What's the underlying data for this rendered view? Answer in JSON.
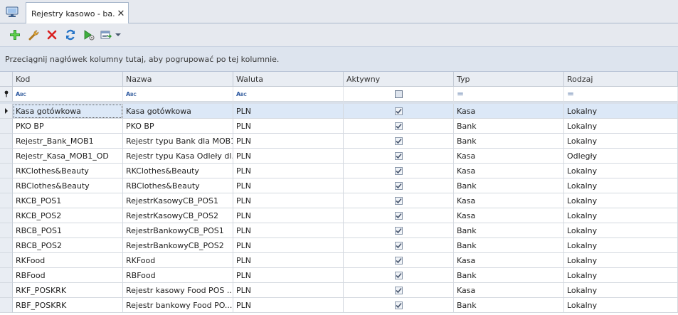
{
  "tab": {
    "label": "Rejestry kasowo - ba...",
    "close": "✕"
  },
  "toolbar": {
    "icons": [
      "add-icon",
      "edit-icon",
      "delete-icon",
      "refresh-icon",
      "run-icon",
      "export-icon",
      "dropdown-arrow-icon"
    ]
  },
  "groupbar": {
    "hint": "Przeciągnij nagłówek kolumny tutaj, aby pogrupować po tej kolumnie."
  },
  "columns": {
    "kod": "Kod",
    "nazwa": "Nazwa",
    "waluta": "Waluta",
    "aktywny": "Aktywny",
    "typ": "Typ",
    "rodzaj": "Rodzaj"
  },
  "filter": {
    "abc": "ABC",
    "eq": "="
  },
  "rows": [
    {
      "kod": "Kasa gotówkowa",
      "nazwa": "Kasa gotówkowa",
      "waluta": "PLN",
      "aktywny": true,
      "typ": "Kasa",
      "rodzaj": "Lokalny"
    },
    {
      "kod": "PKO BP",
      "nazwa": "PKO BP",
      "waluta": "PLN",
      "aktywny": true,
      "typ": "Bank",
      "rodzaj": "Lokalny"
    },
    {
      "kod": "Rejestr_Bank_MOB1",
      "nazwa": "Rejestr typu Bank dla MOB1",
      "waluta": "PLN",
      "aktywny": true,
      "typ": "Bank",
      "rodzaj": "Lokalny"
    },
    {
      "kod": "Rejestr_Kasa_MOB1_OD",
      "nazwa": "Rejestr typu Kasa Odleły dl...",
      "waluta": "PLN",
      "aktywny": true,
      "typ": "Kasa",
      "rodzaj": "Odległy"
    },
    {
      "kod": "RKClothes&Beauty",
      "nazwa": "RKClothes&Beauty",
      "waluta": "PLN",
      "aktywny": true,
      "typ": "Kasa",
      "rodzaj": "Lokalny"
    },
    {
      "kod": "RBClothes&Beauty",
      "nazwa": "RBClothes&Beauty",
      "waluta": "PLN",
      "aktywny": true,
      "typ": "Bank",
      "rodzaj": "Lokalny"
    },
    {
      "kod": "RKCB_POS1",
      "nazwa": "RejestrKasowyCB_POS1",
      "waluta": "PLN",
      "aktywny": true,
      "typ": "Kasa",
      "rodzaj": "Lokalny"
    },
    {
      "kod": "RKCB_POS2",
      "nazwa": "RejestrKasowyCB_POS2",
      "waluta": "PLN",
      "aktywny": true,
      "typ": "Kasa",
      "rodzaj": "Lokalny"
    },
    {
      "kod": "RBCB_POS1",
      "nazwa": "RejestrBankowyCB_POS1",
      "waluta": "PLN",
      "aktywny": true,
      "typ": "Bank",
      "rodzaj": "Lokalny"
    },
    {
      "kod": "RBCB_POS2",
      "nazwa": "RejestrBankowyCB_POS2",
      "waluta": "PLN",
      "aktywny": true,
      "typ": "Bank",
      "rodzaj": "Lokalny"
    },
    {
      "kod": "RKFood",
      "nazwa": "RKFood",
      "waluta": "PLN",
      "aktywny": true,
      "typ": "Kasa",
      "rodzaj": "Lokalny"
    },
    {
      "kod": "RBFood",
      "nazwa": "RBFood",
      "waluta": "PLN",
      "aktywny": true,
      "typ": "Bank",
      "rodzaj": "Lokalny"
    },
    {
      "kod": "RKF_POSKRK",
      "nazwa": "Rejestr kasowy Food POS ...",
      "waluta": "PLN",
      "aktywny": true,
      "typ": "Kasa",
      "rodzaj": "Lokalny"
    },
    {
      "kod": "RBF_POSKRK",
      "nazwa": "Rejestr bankowy Food PO...",
      "waluta": "PLN",
      "aktywny": true,
      "typ": "Bank",
      "rodzaj": "Lokalny"
    }
  ]
}
